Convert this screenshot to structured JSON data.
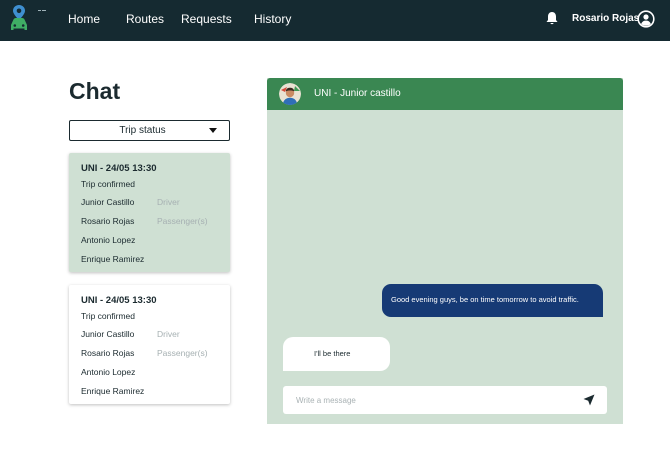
{
  "nav": {
    "logo_icon": "car-pin-logo-icon",
    "links": [
      "Home",
      "Routes",
      "Requests",
      "History"
    ],
    "notifications_icon": "bell-icon",
    "user_name": "Rosario Rojas",
    "user_icon": "user-circle-icon"
  },
  "page": {
    "title": "Chat",
    "trip_status_select": "Trip status"
  },
  "trips": [
    {
      "title": "UNI - 24/05 13:30",
      "status": "Trip confirmed",
      "members": [
        {
          "name": "Junior Castillo",
          "role": "Driver"
        },
        {
          "name": "Rosario Rojas",
          "role": "Passenger(s)"
        },
        {
          "name": "Antonio Lopez",
          "role": ""
        },
        {
          "name": "Enrique Ramirez",
          "role": ""
        }
      ]
    },
    {
      "title": "UNI - 24/05 13:30",
      "status": "Trip confirmed",
      "members": [
        {
          "name": "Junior Castillo",
          "role": "Driver"
        },
        {
          "name": "Rosario Rojas",
          "role": "Passenger(s)"
        },
        {
          "name": "Antonio Lopez",
          "role": ""
        },
        {
          "name": "Enrique Ramirez",
          "role": ""
        }
      ]
    }
  ],
  "chat": {
    "title": "UNI - Junior castillo",
    "messages": [
      {
        "direction": "outgoing",
        "text": "Good evening guys, be on time tomorrow to avoid traffic."
      },
      {
        "direction": "incoming",
        "text": "I'll be there"
      }
    ],
    "input_placeholder": "Write a message",
    "send_icon": "send-icon"
  },
  "colors": {
    "topbar": "#152a31",
    "accent_green": "#3a8752",
    "chat_background": "#cfe0d3",
    "outgoing_bubble": "#163a75"
  }
}
